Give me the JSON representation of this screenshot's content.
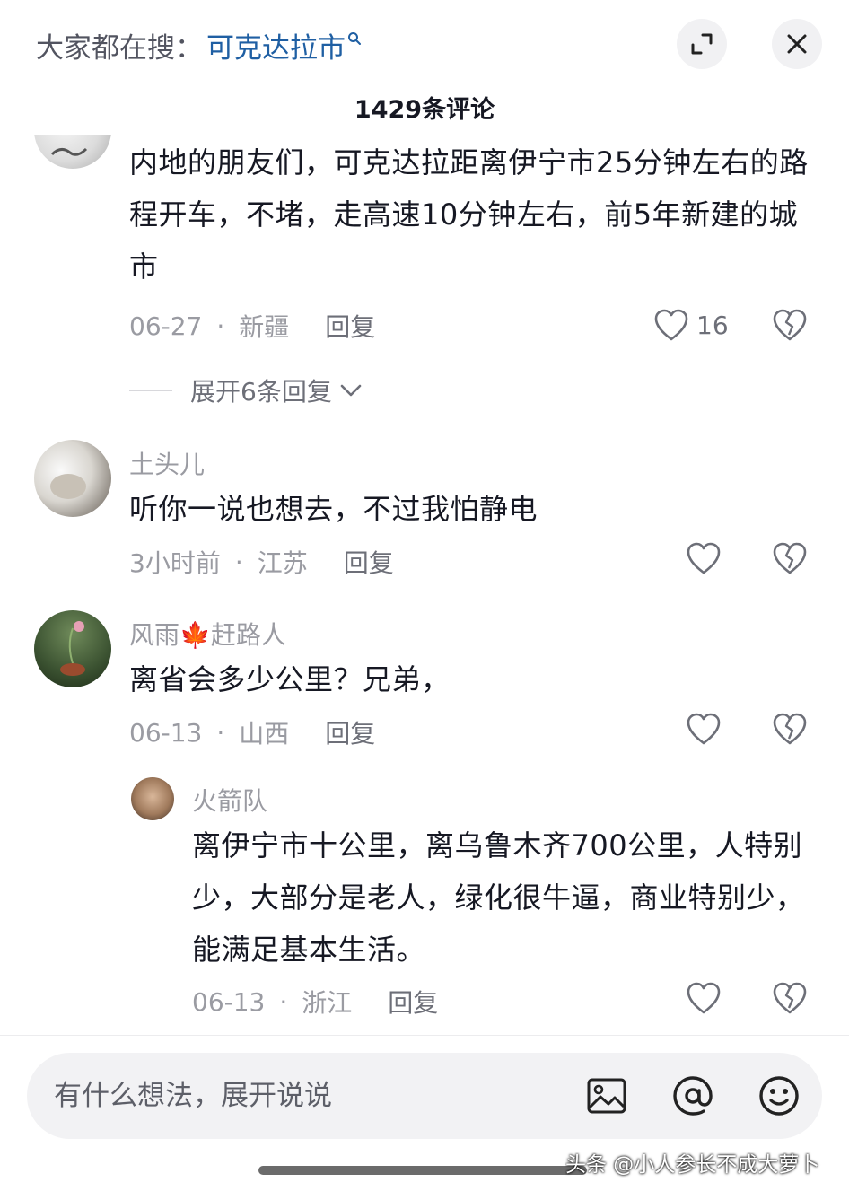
{
  "header": {
    "search_prefix": "大家都在搜：",
    "search_term": "可克达拉市",
    "comment_count": "1429条评论"
  },
  "comments": [
    {
      "text": "内地的朋友们，可克达拉距离伊宁市25分钟左右的路程开车，不堵，走高速10分钟左右，前5年新建的城市",
      "date": "06-27",
      "location": "新疆",
      "reply": "回复",
      "likes": "16",
      "expand_replies": "展开6条回复"
    },
    {
      "username": "土头儿",
      "text": "听你一说也想去，不过我怕静电",
      "date": "3小时前",
      "location": "江苏",
      "reply": "回复"
    },
    {
      "username": "风雨🍁赶路人",
      "text": "离省会多少公里？兄弟，",
      "date": "06-13",
      "location": "山西",
      "reply": "回复",
      "replies": [
        {
          "username": "火箭队",
          "text": "离伊宁市十公里，离乌鲁木齐700公里，人特别少，大部分是老人，绿化很牛逼，商业特别少，能满足基本生活。",
          "date": "06-13",
          "location": "浙江",
          "reply": "回复"
        }
      ]
    }
  ],
  "separator": "·",
  "input": {
    "placeholder": "有什么想法，展开说说"
  },
  "icons": {
    "expand": "expand-icon",
    "close": "close-icon",
    "like": "heart-icon",
    "dislike": "broken-heart-icon",
    "image": "image-icon",
    "mention": "at-icon",
    "emoji": "emoji-icon"
  },
  "watermark": "头条 @小人参长不成大萝卜",
  "colors": {
    "link": "#1f5fa3",
    "secondary_text": "#9a9ba2",
    "primary_text": "#161823"
  }
}
